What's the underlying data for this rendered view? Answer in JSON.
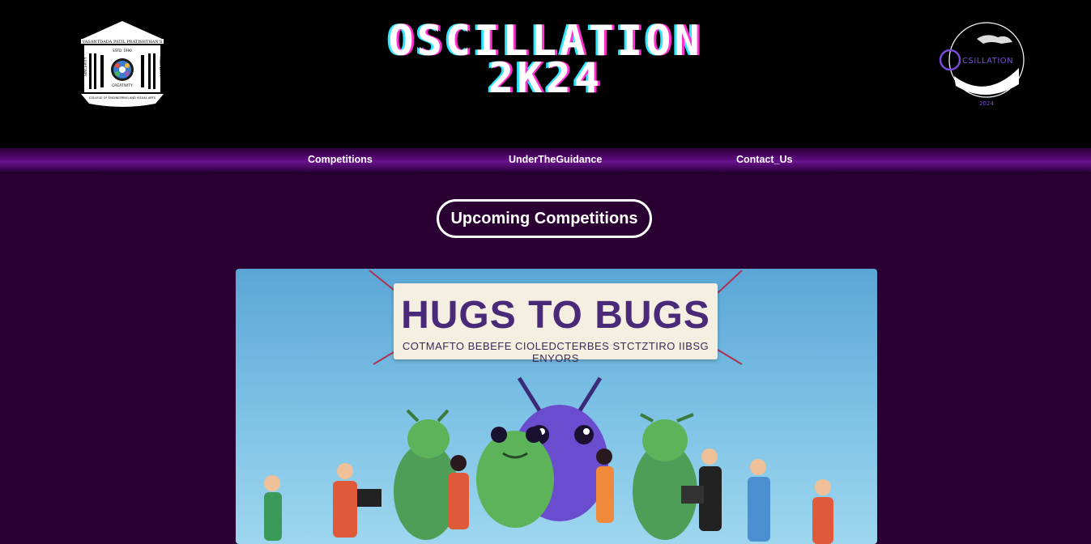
{
  "header": {
    "title_line1": "OSCILLATION",
    "title_line2": "2K24",
    "left_logo": {
      "arch_text": "VASANTDADA PATIL PRATISHTHAN'S",
      "top_text": "ESTD. 1990",
      "left_text": "SINCERITY",
      "right_text": "INGENUITY",
      "bottom_text": "CREATIVITY",
      "footer_text": "COLLEGE OF ENGINEERING AND VISUAL ARTS"
    },
    "right_logo": {
      "wordmark": "CSILLATION",
      "year": "2024"
    }
  },
  "nav": {
    "items": [
      {
        "label": "Competitions"
      },
      {
        "label": "UnderTheGuidance"
      },
      {
        "label": "Contact_Us"
      }
    ]
  },
  "main": {
    "section_title": "Upcoming Competitions",
    "poster": {
      "banner_title": "HUGS TO BUGS",
      "banner_subtitle": "COTMAFTO BEBEFE CIOLEDCTERBES STCTZTIRO IIBSG ENYORS"
    }
  },
  "colors": {
    "page_bg": "#2a0033",
    "header_bg": "#000000",
    "nav_accent": "#6b1390",
    "title_pink": "#ff2fd0",
    "title_cyan": "#2ee6ff",
    "logo_purple": "#7a4bd8"
  }
}
